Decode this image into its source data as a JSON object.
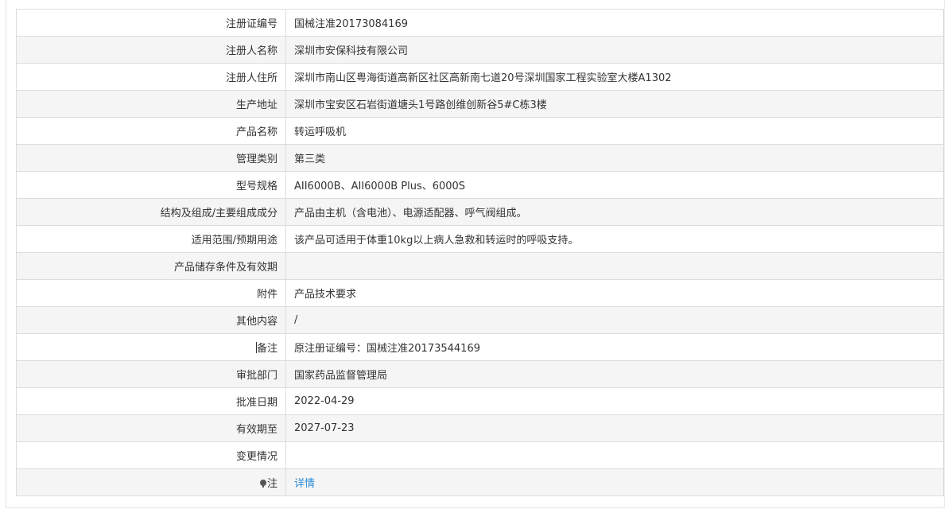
{
  "rows": [
    {
      "label": "注册证编号",
      "value": "国械注准20173084169"
    },
    {
      "label": "注册人名称",
      "value": "深圳市安保科技有限公司"
    },
    {
      "label": "注册人住所",
      "value": "深圳市南山区粤海街道高新区社区高新南七道20号深圳国家工程实验室大楼A1302"
    },
    {
      "label": "生产地址",
      "value": "深圳市宝安区石岩街道塘头1号路创维创新谷5#C栋3楼"
    },
    {
      "label": "产品名称",
      "value": "转运呼吸机"
    },
    {
      "label": "管理类别",
      "value": "第三类"
    },
    {
      "label": "型号规格",
      "value": "AII6000B、AII6000B Plus、6000S"
    },
    {
      "label": "结构及组成/主要组成成分",
      "value": "产品由主机（含电池）、电源适配器、呼气阀组成。"
    },
    {
      "label": "适用范围/预期用途",
      "value": "该产品可适用于体重10kg以上病人急救和转运时的呼吸支持。"
    },
    {
      "label": "产品储存条件及有效期",
      "value": ""
    },
    {
      "label": "附件",
      "value": "产品技术要求"
    },
    {
      "label": "其他内容",
      "value": "/"
    },
    {
      "label": "备注",
      "value": "原注册证编号：国械注准20173544169"
    },
    {
      "label": "审批部门",
      "value": "国家药品监督管理局"
    },
    {
      "label": "批准日期",
      "value": "2022-04-29"
    },
    {
      "label": "有效期至",
      "value": "2027-07-23"
    },
    {
      "label": "变更情况",
      "value": ""
    },
    {
      "label": "注",
      "value": "详情",
      "icon": "pin-icon",
      "link_color": "#2a8ad4"
    }
  ]
}
